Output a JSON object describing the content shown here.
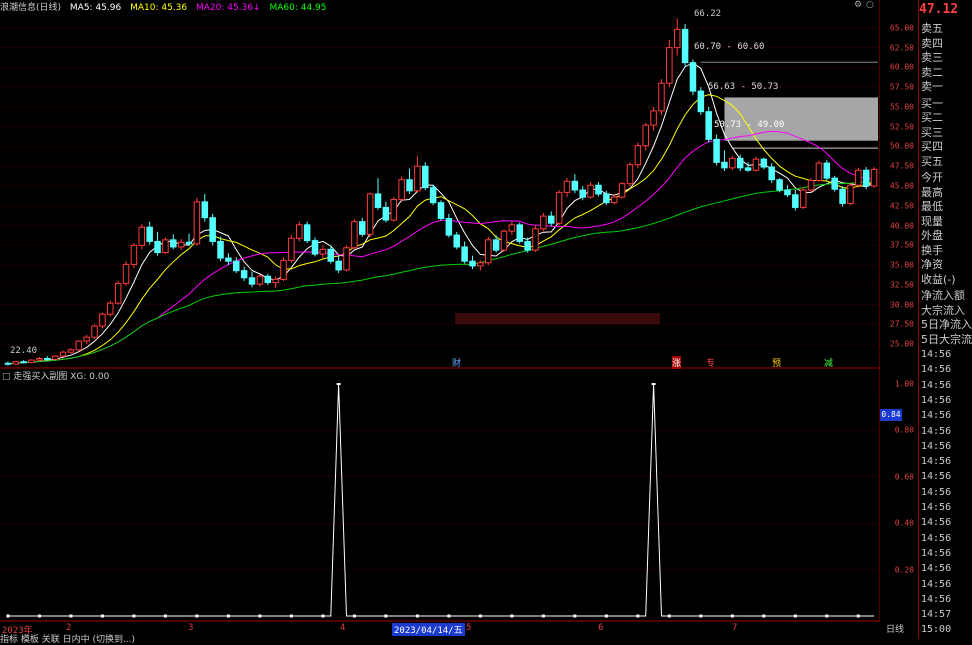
{
  "topbar": {
    "title": "浪潮信息(日线)",
    "ma5": "MA5: 45.96",
    "ma10": "MA10: 45.36",
    "ma20": "MA20: 45.36↓",
    "ma60": "MA60: 44.95",
    "colors": {
      "ma5": "#ffffff",
      "ma10": "#ffff00",
      "ma20": "#ff00ff",
      "ma60": "#00ff00"
    }
  },
  "main_axis": {
    "ticks": [
      "65.00",
      "62.50",
      "60.00",
      "57.50",
      "55.00",
      "52.50",
      "50.00",
      "47.50",
      "45.00",
      "42.50",
      "40.00",
      "37.50",
      "35.00",
      "32.50",
      "30.00",
      "27.50",
      "25.00"
    ]
  },
  "annotations": {
    "high": "66.22",
    "low": "22.40",
    "zone1": "60.70 - 60.60",
    "zone2": "56.63 - 50.73",
    "zone3": "50.73 - 49.00"
  },
  "markers": [
    "财",
    "涨",
    "专",
    "预",
    "减"
  ],
  "sub_chart": {
    "title": "走强买入副图 XG: 0.00",
    "ticks": [
      "1.00",
      "0.80",
      "0.60",
      "0.40",
      "0.20"
    ],
    "badge": "0.84"
  },
  "xaxis": {
    "labels": [
      "2023年",
      "2",
      "3",
      "4",
      "2023/04/14/五",
      "5",
      "6",
      "7"
    ]
  },
  "bottom_tab": "日线",
  "bottom_menu": "指标 模板 关联 日内中 (切换到...)",
  "sidebar": {
    "price": "47.12",
    "sell": [
      "卖五",
      "卖四",
      "卖三",
      "卖二",
      "卖一"
    ],
    "buy": [
      "买一",
      "买二",
      "买三",
      "买四",
      "买五"
    ],
    "stats": [
      "今开",
      "最高",
      "最低",
      "现量",
      "外盘",
      "换手",
      "净资",
      "收益(-)"
    ],
    "flows": [
      "净流入额",
      "大宗流入",
      "5日净流入",
      "5日大宗流"
    ],
    "times": [
      "14:56",
      "14:56",
      "14:56",
      "14:56",
      "14:56",
      "14:56",
      "14:56",
      "14:56",
      "14:56",
      "14:56",
      "14:56",
      "14:56",
      "14:56",
      "14:56",
      "14:56",
      "14:56",
      "14:56",
      "14:57",
      "15:00"
    ]
  },
  "chart_data": [
    {
      "type": "candlestick",
      "title": "浪潮信息(日线)",
      "ylim": [
        22,
        67
      ],
      "candles": [
        [
          22.6,
          22.8,
          22.3,
          22.5
        ],
        [
          22.5,
          22.9,
          22.4,
          22.8
        ],
        [
          22.8,
          23.0,
          22.6,
          22.7
        ],
        [
          22.7,
          23.1,
          22.6,
          23.0
        ],
        [
          23.0,
          23.4,
          22.9,
          23.2
        ],
        [
          23.2,
          23.5,
          23.0,
          23.1
        ],
        [
          23.1,
          23.6,
          23.0,
          23.5
        ],
        [
          23.5,
          24.2,
          23.4,
          24.0
        ],
        [
          24.0,
          24.5,
          23.8,
          24.3
        ],
        [
          24.3,
          25.5,
          24.2,
          25.4
        ],
        [
          25.4,
          26.2,
          25.0,
          25.9
        ],
        [
          25.9,
          27.5,
          25.7,
          27.3
        ],
        [
          27.3,
          29.0,
          27.0,
          28.8
        ],
        [
          28.8,
          30.5,
          28.5,
          30.2
        ],
        [
          30.2,
          33.0,
          30.0,
          32.7
        ],
        [
          32.7,
          35.5,
          32.4,
          35.1
        ],
        [
          35.1,
          37.8,
          34.6,
          37.5
        ],
        [
          37.5,
          40.2,
          37.0,
          39.8
        ],
        [
          39.8,
          40.5,
          37.6,
          38.0
        ],
        [
          38.0,
          39.2,
          36.2,
          36.6
        ],
        [
          36.6,
          38.5,
          36.4,
          38.2
        ],
        [
          38.2,
          38.9,
          37.0,
          37.3
        ],
        [
          37.3,
          38.3,
          36.9,
          37.9
        ],
        [
          37.9,
          39.0,
          37.4,
          37.7
        ],
        [
          37.7,
          43.5,
          37.5,
          43.0
        ],
        [
          43.0,
          44.0,
          40.5,
          41.0
        ],
        [
          41.0,
          41.5,
          37.5,
          38.0
        ],
        [
          38.0,
          38.6,
          35.5,
          35.9
        ],
        [
          35.9,
          36.5,
          35.0,
          35.5
        ],
        [
          35.5,
          36.0,
          34.0,
          34.3
        ],
        [
          34.3,
          34.8,
          33.0,
          33.4
        ],
        [
          33.4,
          34.2,
          32.2,
          32.6
        ],
        [
          32.6,
          33.8,
          32.3,
          33.6
        ],
        [
          33.6,
          33.9,
          32.5,
          32.8
        ],
        [
          32.8,
          33.6,
          32.1,
          33.2
        ],
        [
          33.2,
          36.0,
          33.0,
          35.6
        ],
        [
          35.6,
          38.8,
          35.3,
          38.4
        ],
        [
          38.4,
          40.5,
          38.0,
          40.1
        ],
        [
          40.1,
          40.5,
          37.8,
          38.1
        ],
        [
          38.1,
          38.5,
          36.1,
          36.4
        ],
        [
          36.4,
          37.5,
          35.8,
          37.0
        ],
        [
          37.0,
          37.5,
          35.2,
          35.5
        ],
        [
          35.5,
          36.2,
          34.0,
          34.4
        ],
        [
          34.4,
          37.5,
          34.2,
          37.2
        ],
        [
          37.2,
          40.8,
          37.0,
          40.5
        ],
        [
          40.5,
          41.0,
          38.6,
          38.9
        ],
        [
          38.9,
          44.2,
          38.5,
          44.0
        ],
        [
          44.0,
          46.0,
          42.0,
          42.3
        ],
        [
          42.3,
          43.0,
          40.4,
          40.7
        ],
        [
          40.7,
          43.6,
          40.5,
          43.3
        ],
        [
          43.3,
          46.2,
          43.0,
          45.8
        ],
        [
          45.8,
          47.2,
          44.0,
          44.4
        ],
        [
          44.4,
          48.8,
          44.2,
          47.5
        ],
        [
          47.5,
          48.0,
          44.5,
          44.8
        ],
        [
          44.8,
          45.2,
          42.6,
          42.9
        ],
        [
          42.9,
          43.2,
          40.6,
          40.9
        ],
        [
          40.9,
          41.5,
          38.5,
          38.8
        ],
        [
          38.8,
          39.2,
          37.0,
          37.3
        ],
        [
          37.3,
          38.0,
          35.2,
          35.5
        ],
        [
          35.5,
          36.2,
          34.5,
          34.9
        ],
        [
          34.9,
          35.6,
          34.3,
          35.3
        ],
        [
          35.3,
          38.6,
          35.0,
          38.2
        ],
        [
          38.2,
          38.8,
          36.6,
          36.9
        ],
        [
          36.9,
          39.5,
          36.7,
          39.3
        ],
        [
          39.3,
          40.5,
          38.8,
          40.1
        ],
        [
          40.1,
          40.4,
          37.7,
          38.0
        ],
        [
          38.0,
          38.5,
          36.6,
          36.9
        ],
        [
          36.9,
          40.0,
          36.7,
          39.6
        ],
        [
          39.6,
          41.6,
          39.3,
          41.2
        ],
        [
          41.2,
          41.8,
          39.9,
          40.3
        ],
        [
          40.3,
          44.5,
          40.0,
          44.2
        ],
        [
          44.2,
          46.0,
          43.6,
          45.6
        ],
        [
          45.6,
          46.5,
          44.1,
          44.5
        ],
        [
          44.5,
          45.0,
          43.2,
          43.6
        ],
        [
          43.6,
          45.5,
          43.4,
          45.1
        ],
        [
          45.1,
          45.5,
          43.7,
          44.0
        ],
        [
          44.0,
          44.4,
          42.6,
          42.9
        ],
        [
          42.9,
          44.0,
          42.7,
          43.6
        ],
        [
          43.6,
          45.5,
          43.4,
          45.3
        ],
        [
          45.3,
          48.0,
          45.0,
          47.7
        ],
        [
          47.7,
          50.5,
          47.3,
          50.1
        ],
        [
          50.1,
          53.0,
          49.5,
          52.7
        ],
        [
          52.7,
          55.0,
          52.0,
          54.5
        ],
        [
          54.5,
          58.5,
          54.0,
          58.0
        ],
        [
          58.0,
          63.5,
          57.5,
          62.5
        ],
        [
          62.5,
          66.2,
          61.5,
          64.8
        ],
        [
          64.8,
          65.5,
          60.0,
          60.6
        ],
        [
          60.6,
          61.0,
          56.5,
          57.0
        ],
        [
          57.0,
          57.5,
          54.0,
          54.4
        ],
        [
          54.4,
          55.0,
          50.5,
          50.9
        ],
        [
          50.9,
          51.5,
          47.6,
          48.0
        ],
        [
          48.0,
          49.5,
          46.9,
          47.3
        ],
        [
          47.3,
          48.8,
          47.0,
          48.5
        ],
        [
          48.5,
          49.0,
          46.9,
          47.3
        ],
        [
          47.3,
          48.0,
          46.8,
          47.0
        ],
        [
          47.0,
          48.7,
          46.8,
          48.4
        ],
        [
          48.4,
          48.6,
          47.1,
          47.4
        ],
        [
          47.4,
          47.9,
          45.4,
          45.8
        ],
        [
          45.8,
          46.0,
          44.2,
          44.5
        ],
        [
          44.5,
          45.1,
          43.6,
          43.9
        ],
        [
          43.9,
          44.5,
          41.9,
          42.3
        ],
        [
          42.3,
          44.8,
          42.1,
          44.5
        ],
        [
          44.5,
          46.0,
          44.2,
          45.7
        ],
        [
          45.7,
          48.2,
          45.5,
          47.9
        ],
        [
          47.9,
          48.3,
          45.7,
          46.0
        ],
        [
          46.0,
          46.3,
          44.3,
          44.6
        ],
        [
          44.6,
          45.0,
          42.4,
          42.8
        ],
        [
          42.8,
          45.4,
          42.6,
          45.1
        ],
        [
          45.1,
          47.3,
          44.8,
          47.0
        ],
        [
          47.0,
          47.4,
          44.6,
          45.0
        ],
        [
          45.0,
          47.4,
          44.8,
          47.1
        ]
      ],
      "ma": {
        "MA5": 45.96,
        "MA10": 45.36,
        "MA20": 45.36,
        "MA60": 44.95
      }
    },
    {
      "type": "line",
      "title": "走强买入副图",
      "ylim": [
        0,
        1.0
      ],
      "series": [
        {
          "name": "XG",
          "spikes_at_index": [
            42,
            82
          ],
          "value": 1.0
        }
      ]
    }
  ]
}
